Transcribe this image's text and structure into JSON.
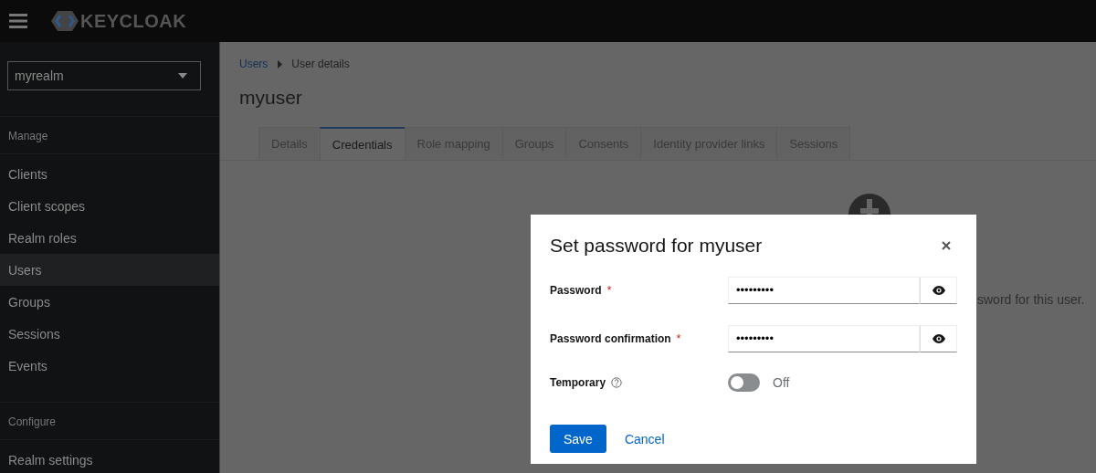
{
  "header": {
    "logo": "KEYCLOAK"
  },
  "sidebar": {
    "realm": "myrealm",
    "sections": [
      {
        "title": "Manage",
        "items": [
          {
            "label": "Clients",
            "selected": false
          },
          {
            "label": "Client scopes",
            "selected": false
          },
          {
            "label": "Realm roles",
            "selected": false
          },
          {
            "label": "Users",
            "selected": true
          },
          {
            "label": "Groups",
            "selected": false
          },
          {
            "label": "Sessions",
            "selected": false
          },
          {
            "label": "Events",
            "selected": false
          }
        ]
      },
      {
        "title": "Configure",
        "items": [
          {
            "label": "Realm settings",
            "selected": false
          }
        ]
      }
    ]
  },
  "breadcrumb": [
    {
      "label": "Users",
      "kind": "link"
    },
    {
      "label": "User details",
      "kind": "current"
    }
  ],
  "page_title": "myuser",
  "tabs": [
    {
      "label": "Details",
      "selected": false
    },
    {
      "label": "Credentials",
      "selected": true
    },
    {
      "label": "Role mapping",
      "selected": false
    },
    {
      "label": "Groups",
      "selected": false
    },
    {
      "label": "Consents",
      "selected": false
    },
    {
      "label": "Identity provider links",
      "selected": false
    },
    {
      "label": "Sessions",
      "selected": false
    }
  ],
  "empty_state": {
    "text": "sword for this user."
  },
  "dialog": {
    "title": "Set password for myuser",
    "fields": [
      {
        "kind": "password",
        "label": "Password",
        "required_mark": "*",
        "value": "•••••••••"
      },
      {
        "kind": "password",
        "label": "Password confirmation",
        "required_mark": "*",
        "value": "•••••••••"
      },
      {
        "kind": "switch",
        "label": "Temporary",
        "help": true,
        "on": false,
        "state_label": "Off"
      }
    ],
    "buttons": [
      {
        "label": "Save",
        "kind": "primary"
      },
      {
        "label": "Cancel",
        "kind": "link"
      }
    ]
  }
}
